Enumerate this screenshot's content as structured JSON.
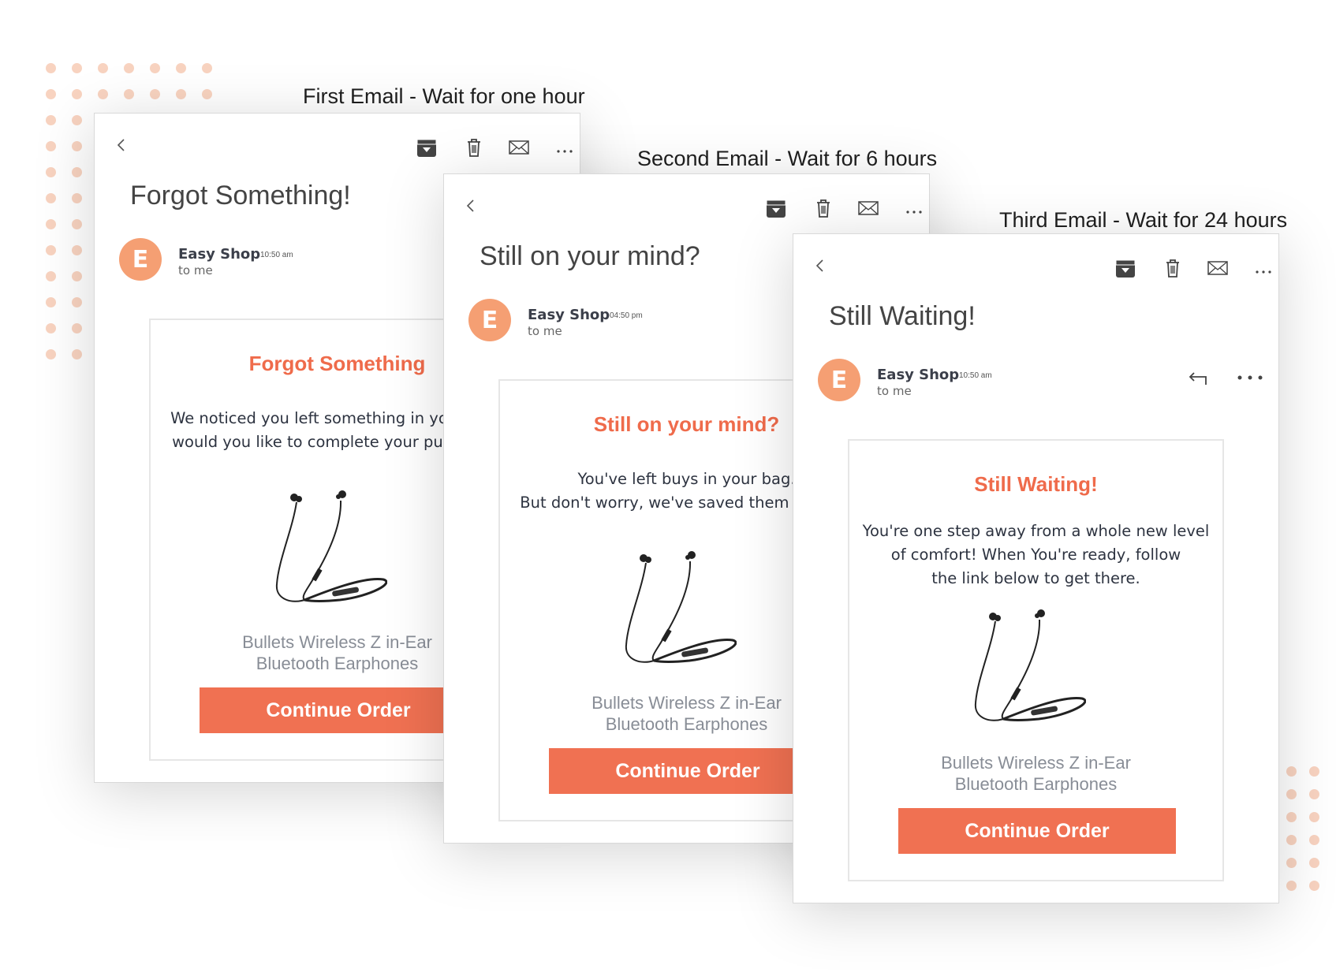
{
  "colors": {
    "accent": "#f07152",
    "title_orange": "#ef6b4b",
    "avatar": "#f59f73",
    "dots": "#f8d3c0"
  },
  "icons": {
    "toolbar": [
      "chevron-left-icon",
      "archive-icon",
      "trash-icon",
      "mail-icon",
      "more-icon"
    ],
    "message": [
      "reply-icon",
      "more-icon"
    ]
  },
  "emails": [
    {
      "caption": "First Email - Wait for one hour",
      "subject": "Forgot Something!",
      "avatar_letter": "E",
      "sender": "Easy Shop",
      "time": "10:50 am",
      "to": "to me",
      "card_title": "Forgot Something",
      "body_lines": [
        "We noticed you left something in your cart,",
        "would you like to complete your purchase?"
      ],
      "product_line1": "Bullets Wireless Z in-Ear",
      "product_line2": "Bluetooth Earphones",
      "cta": "Continue Order"
    },
    {
      "caption": "Second Email - Wait for 6 hours",
      "subject": "Still on your mind?",
      "avatar_letter": "E",
      "sender": "Easy Shop",
      "time": "04:50 pm",
      "to": "to me",
      "card_title": "Still on your mind?",
      "body_lines": [
        "You've left buys in your bag.",
        "But don't worry, we've saved them for you."
      ],
      "product_line1": "Bullets Wireless Z in-Ear",
      "product_line2": "Bluetooth Earphones",
      "cta": "Continue Order"
    },
    {
      "caption": "Third Email - Wait for 24 hours",
      "subject": "Still Waiting!",
      "avatar_letter": "E",
      "sender": "Easy Shop",
      "time": "10:50 am",
      "to": "to me",
      "card_title": "Still Waiting!",
      "body_lines": [
        "You're one step away from a whole new level",
        "of comfort! When You're ready, follow",
        "the link below to get there."
      ],
      "product_line1": "Bullets Wireless Z in-Ear",
      "product_line2": "Bluetooth Earphones",
      "cta": "Continue Order"
    }
  ]
}
